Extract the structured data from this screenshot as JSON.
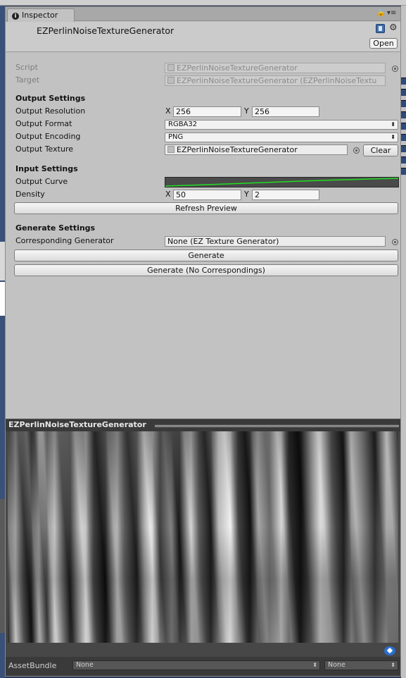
{
  "window": {
    "tab_label": "Inspector",
    "lock_glyph": "🔒",
    "menu_glyph": "▾≡",
    "component_title": "EZPerlinNoiseTextureGenerator",
    "open_label": "Open"
  },
  "fields": {
    "script_label": "Script",
    "script_value": "EZPerlinNoiseTextureGenerator",
    "target_label": "Target",
    "target_value": "EZPerlinNoiseTextureGenerator (EZPerlinNoiseTextu"
  },
  "output": {
    "section": "Output Settings",
    "resolution_label": "Output Resolution",
    "res_x_label": "X",
    "res_x": "256",
    "res_y_label": "Y",
    "res_y": "256",
    "format_label": "Output Format",
    "format_value": "RGBA32",
    "encoding_label": "Output Encoding",
    "encoding_value": "PNG",
    "texture_label": "Output Texture",
    "texture_value": "EZPerlinNoiseTextureGenerator",
    "clear_label": "Clear"
  },
  "input": {
    "section": "Input Settings",
    "curve_label": "Output Curve",
    "density_label": "Density",
    "density_x_label": "X",
    "density_x": "50",
    "density_y_label": "Y",
    "density_y": "2",
    "refresh_label": "Refresh Preview"
  },
  "generate": {
    "section": "Generate Settings",
    "corresponding_label": "Corresponding Generator",
    "corresponding_value": "None (EZ Texture Generator)",
    "generate_label": "Generate",
    "generate_no_corr_label": "Generate (No Correspondings)"
  },
  "preview": {
    "title": "EZPerlinNoiseTextureGenerator",
    "bundle_label": "AssetBundle",
    "bundle_value": "None",
    "variant_value": "None"
  },
  "colors": {
    "panel": "#c2c2c2",
    "curve_line": "#22dd22",
    "preview_bg": "#474747"
  }
}
